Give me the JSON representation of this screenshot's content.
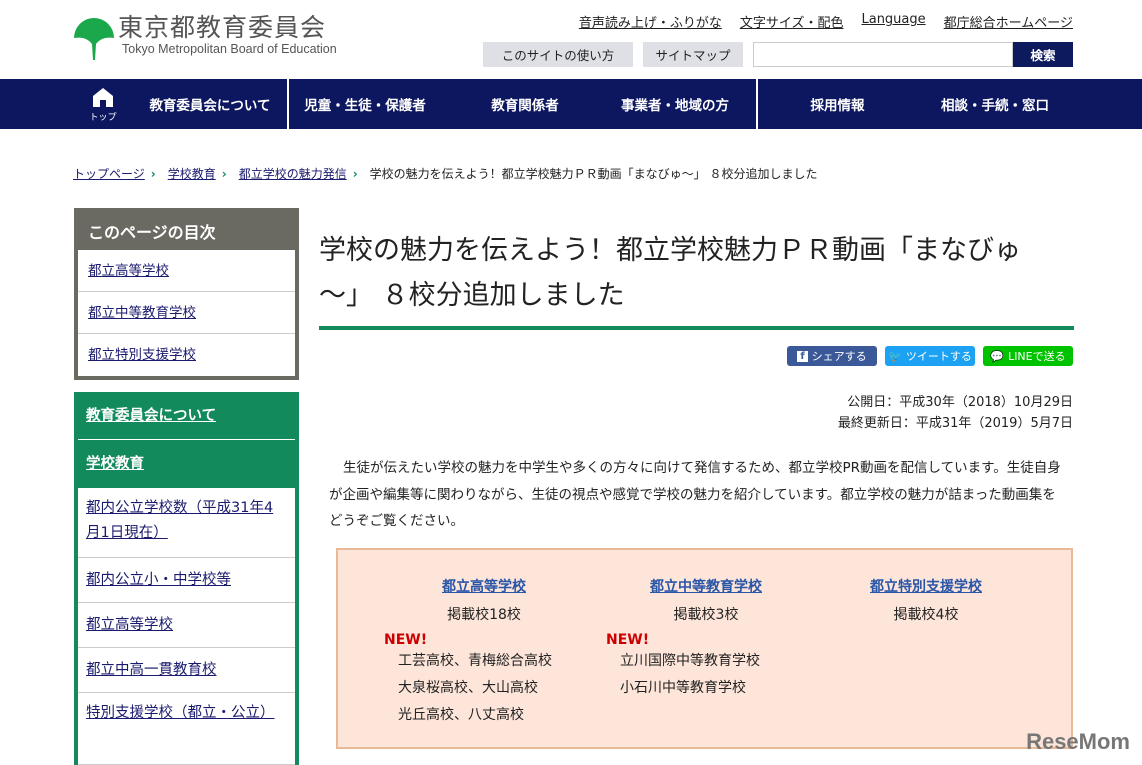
{
  "header": {
    "logo_jp": "東京都教育委員会",
    "logo_en": "Tokyo Metropolitan Board of Education",
    "util_links": [
      "音声読み上げ・ふりがな",
      "文字サイズ・配色",
      "Language",
      "都庁総合ホームページ"
    ],
    "how_to_use": "このサイトの使い方",
    "sitemap": "サイトマップ",
    "search_placeholder": "",
    "search_button": "検索"
  },
  "nav": {
    "home": "トップ",
    "items": [
      "教育委員会について",
      "児童・生徒・保護者",
      "教育関係者",
      "事業者・地域の方",
      "採用情報",
      "相談・手続・窓口"
    ]
  },
  "breadcrumb": [
    "トップページ",
    "学校教育",
    "都立学校の魅力発信",
    "学校の魅力を伝えよう！都立学校魅力ＰＲ動画「まなびゅ～」 ８校分追加しました"
  ],
  "toc": {
    "title": "このページの目次",
    "items": [
      "都立高等学校",
      "都立中等教育学校",
      "都立特別支援学校"
    ]
  },
  "sidenav": {
    "top": [
      "教育委員会について",
      "学校教育"
    ],
    "sub": [
      "都内公立学校数（平成31年4月1日現在）",
      "都内公立小・中学校等",
      "都立高等学校",
      "都立中高一貫教育校",
      "特別支援学校（都立・公立）"
    ]
  },
  "title": "学校の魅力を伝えよう！都立学校魅力ＰＲ動画「まなびゅ～」 ８校分追加しました",
  "share": {
    "facebook": "シェアする",
    "twitter": "ツイートする",
    "line": "LINEで送る"
  },
  "dates": {
    "published": "公開日：平成30年（2018）10月29日",
    "updated": "最終更新日：平成31年（2019）5月7日"
  },
  "intro": "生徒が伝えたい学校の魅力を中学生や多くの方々に向けて発信するため、都立学校PR動画を配信しています。生徒自身が企画や編集等に関わりながら、生徒の視点や感覚で学校の魅力を紹介しています。都立学校の魅力が詰まった動画集をどうぞご覧ください。",
  "schools": [
    {
      "name": "都立高等学校",
      "count": "掲載校18校",
      "new": "NEW!",
      "list": [
        "工芸高校、青梅総合高校",
        "大泉桜高校、大山高校",
        "光丘高校、八丈高校"
      ]
    },
    {
      "name": "都立中等教育学校",
      "count": "掲載校3校",
      "new": "NEW!",
      "list": [
        "立川国際中等教育学校",
        "小石川中等教育学校"
      ]
    },
    {
      "name": "都立特別支援学校",
      "count": "掲載校4校"
    }
  ],
  "watermark": "ReseMom",
  "colors": {
    "navy": "#0d1760",
    "green": "#128a5c"
  }
}
